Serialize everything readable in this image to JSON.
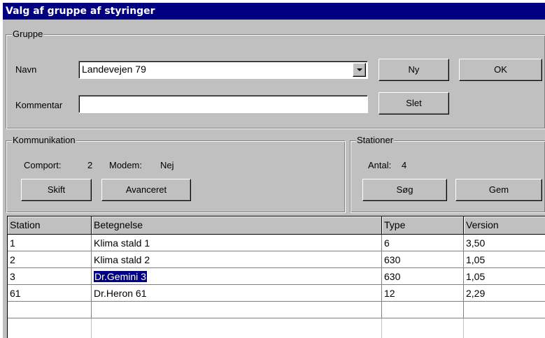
{
  "window": {
    "title": "Valg af gruppe af styringer"
  },
  "gruppe": {
    "legend": "Gruppe",
    "navn_label": "Navn",
    "navn_value": "Landevejen 79",
    "kommentar_label": "Kommentar",
    "kommentar_value": "",
    "ny_label": "Ny",
    "ok_label": "OK",
    "slet_label": "Slet"
  },
  "kommunikation": {
    "legend": "Kommunikation",
    "comport_label": "Comport:",
    "comport_value": "2",
    "modem_label": "Modem:",
    "modem_value": "Nej",
    "skift_label": "Skift",
    "avanceret_label": "Avanceret"
  },
  "stationer": {
    "legend": "Stationer",
    "antal_label": "Antal:",
    "antal_value": "4",
    "sog_label": "Søg",
    "gem_label": "Gem"
  },
  "table": {
    "columns": [
      "Station",
      "Betegnelse",
      "Type",
      "Version"
    ],
    "rows": [
      [
        "1",
        "Klima stald 1",
        "6",
        "3,50"
      ],
      [
        "2",
        "Klima stald 2",
        "630",
        "1,05"
      ],
      [
        "3",
        "Dr.Gemini 3",
        "630",
        "1,05"
      ],
      [
        "61",
        "Dr.Heron 61",
        "12",
        "2,29"
      ]
    ],
    "selected_row": 2
  },
  "colors": {
    "titlebar": "#000080",
    "face": "#c0c0c0",
    "selection": "#000080"
  }
}
